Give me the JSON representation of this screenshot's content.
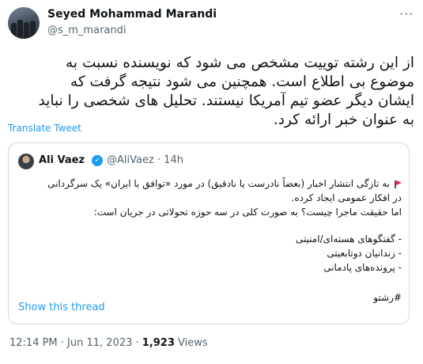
{
  "author": {
    "name": "Seyed Mohammad Marandi",
    "handle": "@s_m_marandi"
  },
  "tweet": {
    "lines": [
      "از این رشته توییت مشخص می شود که نویسنده نسبت به",
      "موضوع بی اطلاع است.  همچنین می شود نتیجه گرفت که",
      "ایشان دیگر عضو تیم آمریکا نیستند. تحلیل های شخصی را نباید",
      "به عنوان خبر ارائه کرد."
    ],
    "translate_label": "Translate Tweet"
  },
  "quote": {
    "name": "Ali Vaez",
    "handle_time": "@AliVaez · 14h",
    "lines": [
      "به تازگی انتشار اخبار (بعضاً نادرست یا نادقیق) در مورد «توافق با ایران» یک سرگردانی",
      "در افکار عمومی ایجاد کرده.",
      "اما حقیقت ماجرا چیست؟ به صورت کلی در سه حوزه تحولاتی در جریان است:",
      "- گفتگوهای هسته‌ای/امنیتی",
      "- زندانیان دوتابعیتی",
      "- پرونده‌های پادمانی",
      "#رشتو"
    ],
    "show_thread_label": "Show this thread"
  },
  "meta": {
    "time_date": "12:14 PM · Jun 11, 2023 · ",
    "views_count": "1,923",
    "views_label": " Views"
  },
  "icons": {
    "more": "more-options-icon",
    "flag": "red-flag-icon",
    "verified": "verified-badge-icon"
  }
}
